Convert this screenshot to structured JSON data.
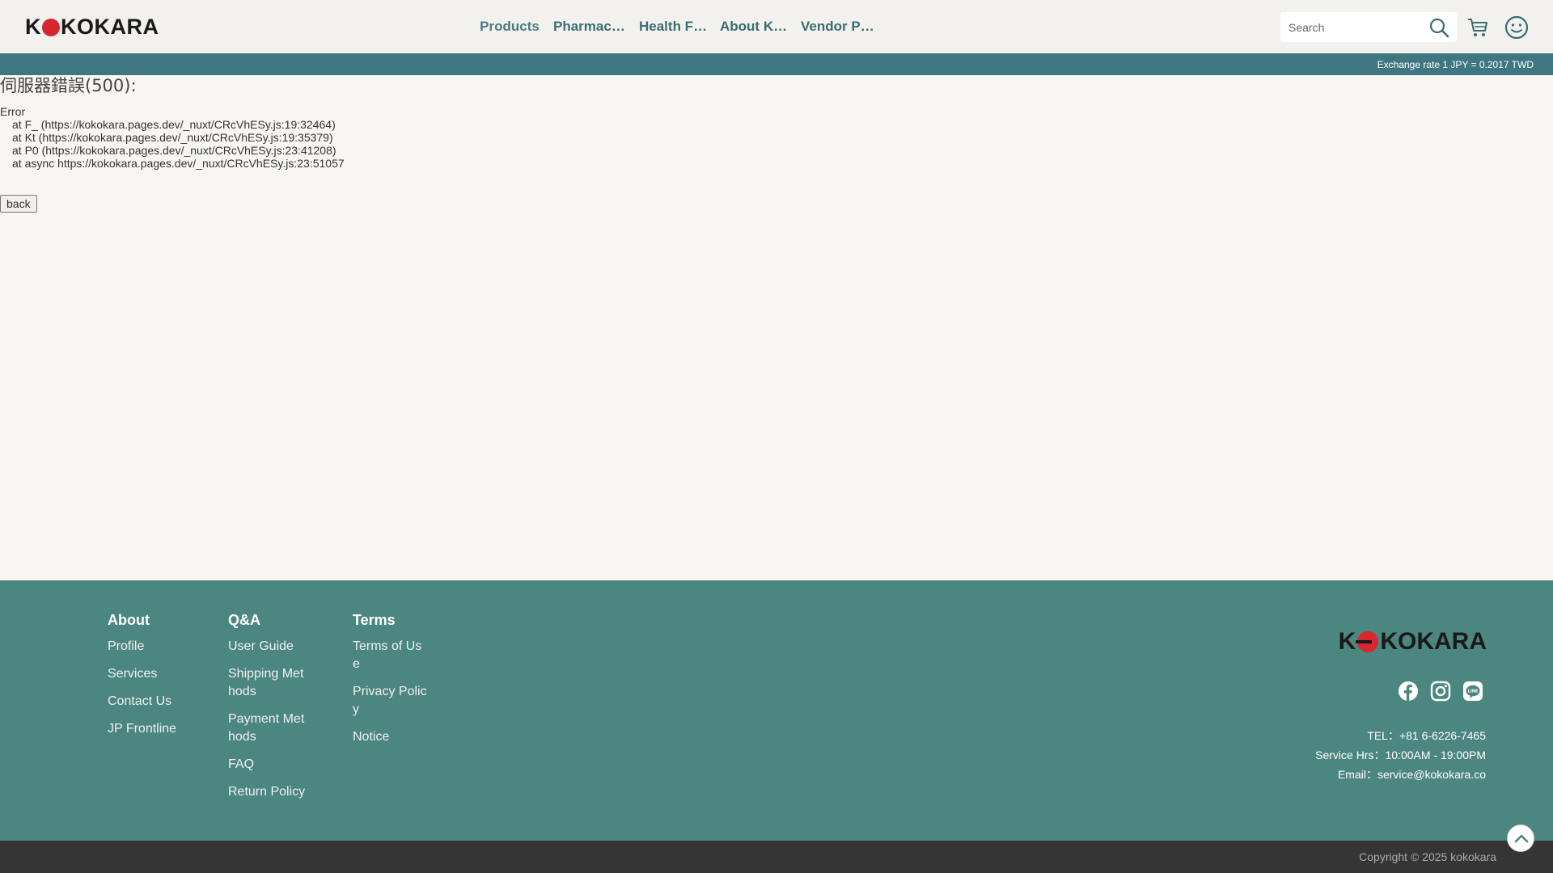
{
  "header": {
    "logo_text": "KOKOKARA",
    "nav": [
      "Products",
      "Pharmace…",
      "Health Fo…",
      "About KO…",
      "Vendor Pa…"
    ],
    "search_placeholder": "Search"
  },
  "exchange": {
    "text": "Exchange rate 1 JPY = 0.2017 TWD"
  },
  "error": {
    "title": "伺服器錯誤(500):",
    "label": "Error",
    "stack": [
      "at F_ (https://kokokara.pages.dev/_nuxt/CRcVhESy.js:19:32464)",
      "at Kt (https://kokokara.pages.dev/_nuxt/CRcVhESy.js:19:35379)",
      "at P0 (https://kokokara.pages.dev/_nuxt/CRcVhESy.js:23:41208)",
      "at async https://kokokara.pages.dev/_nuxt/CRcVhESy.js:23:51057"
    ],
    "back_label": "back"
  },
  "footer": {
    "about": {
      "heading": "About",
      "links": [
        "Profile",
        "Services",
        "Contact Us",
        "JP Frontline"
      ]
    },
    "qa": {
      "heading": "Q&A",
      "links": [
        "User Guide",
        "Shipping Methods",
        "Payment Methods",
        "FAQ",
        "Return Policy"
      ]
    },
    "terms": {
      "heading": "Terms",
      "links": [
        "Terms of Use",
        "Privacy Policy",
        "Notice"
      ]
    },
    "logo_text": "KOKOKARA",
    "contact": {
      "tel": "TEL：+81 6-6226-7465",
      "hours": "Service Hrs：10:00AM - 19:00PM",
      "email": "Email：service@kokokara.co"
    },
    "copyright": "Copyright © 2025 kokokara"
  },
  "colors": {
    "nav_teal": "#3b6e72",
    "exchange_bar": "#3e7782",
    "footer_bg": "#4c8680",
    "logo_red": "#d7262d",
    "copyright_bg": "#353535"
  }
}
